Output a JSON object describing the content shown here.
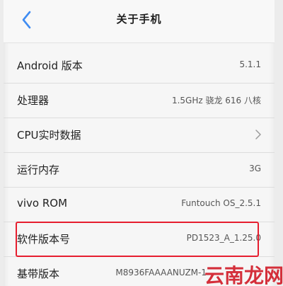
{
  "header": {
    "title": "关于手机"
  },
  "rows": [
    {
      "label": "Android 版本",
      "value": "5.1.1"
    },
    {
      "label": "处理器",
      "value": "1.5GHz 骁龙 616 八核"
    },
    {
      "label": "CPU实时数据",
      "value": ""
    },
    {
      "label": "运行内存",
      "value": "3G"
    },
    {
      "label": "vivo ROM",
      "value": "Funtouch OS_2.5.1"
    },
    {
      "label": "软件版本号",
      "value": "PD1523_A_1.25.0"
    },
    {
      "label": "基带版本",
      "value": "M8936FAAAANUZM-1"
    }
  ],
  "watermark": "云南龙网",
  "colors": {
    "highlight": "#e61e2f",
    "watermark": "#d21f2b",
    "back": "#3f8cf2"
  },
  "icons": {
    "back": "chevron-left-icon",
    "arrow": "chevron-right-icon"
  }
}
